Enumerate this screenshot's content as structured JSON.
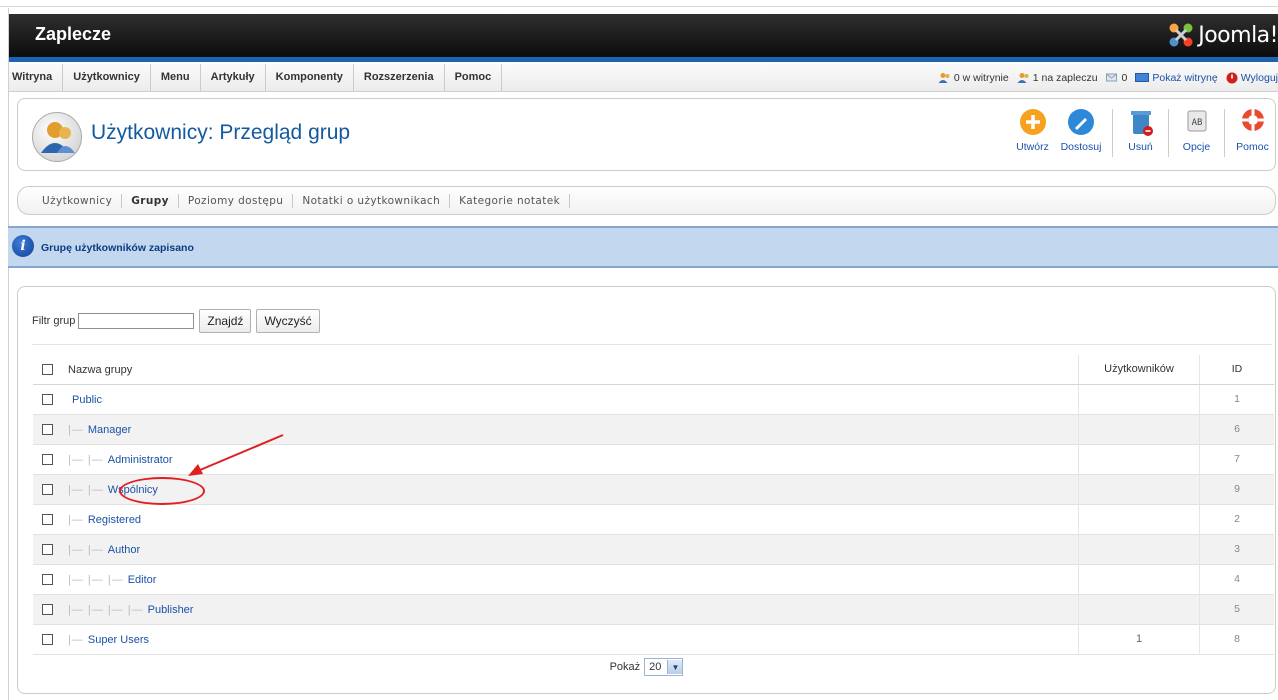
{
  "header": {
    "title": "Zaplecze",
    "brand": "Joomla!"
  },
  "menu": {
    "items": [
      "Witryna",
      "Użytkownicy",
      "Menu",
      "Artykuły",
      "Komponenty",
      "Rozszerzenia",
      "Pomoc"
    ]
  },
  "status": {
    "site_users": "0 w witrynie",
    "admin_users": "1 na zapleczu",
    "messages": "0",
    "show_site": "Pokaż witrynę",
    "logout": "Wyloguj"
  },
  "page": {
    "title": "Użytkownicy: Przegląd grup"
  },
  "toolbar": {
    "create": "Utwórz",
    "edit": "Dostosuj",
    "delete": "Usuń",
    "options": "Opcje",
    "help": "Pomoc"
  },
  "subnav": {
    "items": [
      "Użytkownicy",
      "Grupy",
      "Poziomy dostępu",
      "Notatki o użytkownikach",
      "Kategorie notatek"
    ]
  },
  "message": {
    "text": "Grupę użytkowników zapisano"
  },
  "filter": {
    "label": "Filtr grup",
    "value": "",
    "search_button": "Znajdź",
    "clear_button": "Wyczyść"
  },
  "table": {
    "headers": {
      "name": "Nazwa grupy",
      "users": "Użytkowników",
      "id": "ID"
    },
    "rows": [
      {
        "tree": "",
        "name": "Public",
        "users": "",
        "id": "1"
      },
      {
        "tree": "|—",
        "name": "Manager",
        "users": "",
        "id": "6"
      },
      {
        "tree": "|— |—",
        "name": "Administrator",
        "users": "",
        "id": "7"
      },
      {
        "tree": "|— |—",
        "name": "Wspólnicy",
        "users": "",
        "id": "9"
      },
      {
        "tree": "|—",
        "name": "Registered",
        "users": "",
        "id": "2"
      },
      {
        "tree": "|— |—",
        "name": "Author",
        "users": "",
        "id": "3"
      },
      {
        "tree": "|— |— |—",
        "name": "Editor",
        "users": "",
        "id": "4"
      },
      {
        "tree": "|— |— |— |—",
        "name": "Publisher",
        "users": "",
        "id": "5"
      },
      {
        "tree": "|—",
        "name": "Super Users",
        "users": "1",
        "id": "8"
      }
    ]
  },
  "pagination": {
    "label": "Pokaż",
    "limit": "20"
  },
  "colors": {
    "link": "#1a52a8",
    "header_bg": "#111111",
    "header_stripe": "#1b64b4",
    "annotation": "#e02020"
  }
}
